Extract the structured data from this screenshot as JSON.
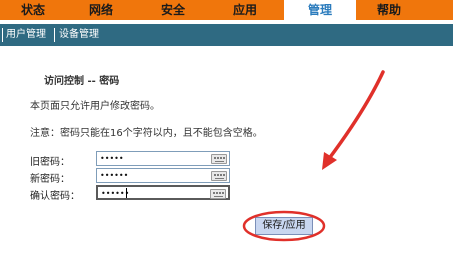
{
  "nav": {
    "items": [
      {
        "label": "状态",
        "active": false
      },
      {
        "label": "网络",
        "active": false
      },
      {
        "label": "安全",
        "active": false
      },
      {
        "label": "应用",
        "active": false
      },
      {
        "label": "管理",
        "active": true
      },
      {
        "label": "帮助",
        "active": false
      }
    ]
  },
  "subnav": {
    "items": [
      {
        "label": "用户管理"
      },
      {
        "label": "设备管理"
      }
    ]
  },
  "content": {
    "title": "访问控制 -- 密码",
    "description": "本页面只允许用户修改密码。",
    "note": "注意：密码只能在16个字符以内，且不能包含空格。"
  },
  "form": {
    "old_password": {
      "label": "旧密码：",
      "value": "•••••"
    },
    "new_password": {
      "label": "新密码：",
      "value": "••••••"
    },
    "confirm_password": {
      "label": "确认密码：",
      "value": "••••••"
    }
  },
  "actions": {
    "save_label": "保存/应用"
  },
  "colors": {
    "nav_bg": "#f0760c",
    "subnav_bg": "#2f6a82",
    "annotation_red": "#e0302a",
    "button_bg": "#c8d6f0"
  },
  "icons": {
    "keyboard": "keyboard-icon"
  }
}
